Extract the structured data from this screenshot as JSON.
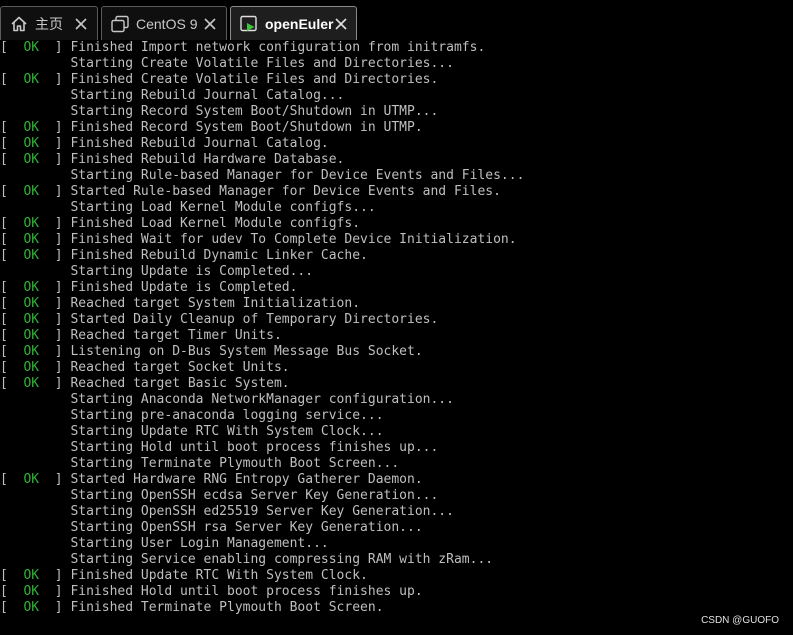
{
  "tabs": [
    {
      "label": "主页",
      "icon": "home-icon",
      "active": false
    },
    {
      "label": "CentOS 9",
      "icon": "terminal-window-icon",
      "active": false
    },
    {
      "label": "openEuler",
      "icon": "terminal-play-icon",
      "active": true
    }
  ],
  "colors": {
    "background": "#000000",
    "text": "#bfbfbf",
    "ok": "#2fb52f",
    "tab_active": "#1e1e1e",
    "tab_inactive": "#0f0f0f"
  },
  "console": {
    "ok_label": "OK",
    "lines": [
      {
        "ok": true,
        "text": "Finished Import network configuration from initramfs."
      },
      {
        "ok": false,
        "text": "Starting Create Volatile Files and Directories..."
      },
      {
        "ok": true,
        "text": "Finished Create Volatile Files and Directories."
      },
      {
        "ok": false,
        "text": "Starting Rebuild Journal Catalog..."
      },
      {
        "ok": false,
        "text": "Starting Record System Boot/Shutdown in UTMP..."
      },
      {
        "ok": true,
        "text": "Finished Record System Boot/Shutdown in UTMP."
      },
      {
        "ok": true,
        "text": "Finished Rebuild Journal Catalog."
      },
      {
        "ok": true,
        "text": "Finished Rebuild Hardware Database."
      },
      {
        "ok": false,
        "text": "Starting Rule-based Manager for Device Events and Files..."
      },
      {
        "ok": true,
        "text": "Started Rule-based Manager for Device Events and Files."
      },
      {
        "ok": false,
        "text": "Starting Load Kernel Module configfs..."
      },
      {
        "ok": true,
        "text": "Finished Load Kernel Module configfs."
      },
      {
        "ok": true,
        "text": "Finished Wait for udev To Complete Device Initialization."
      },
      {
        "ok": true,
        "text": "Finished Rebuild Dynamic Linker Cache."
      },
      {
        "ok": false,
        "text": "Starting Update is Completed..."
      },
      {
        "ok": true,
        "text": "Finished Update is Completed."
      },
      {
        "ok": true,
        "text": "Reached target System Initialization."
      },
      {
        "ok": true,
        "text": "Started Daily Cleanup of Temporary Directories."
      },
      {
        "ok": true,
        "text": "Reached target Timer Units."
      },
      {
        "ok": true,
        "text": "Listening on D-Bus System Message Bus Socket."
      },
      {
        "ok": true,
        "text": "Reached target Socket Units."
      },
      {
        "ok": true,
        "text": "Reached target Basic System."
      },
      {
        "ok": false,
        "text": "Starting Anaconda NetworkManager configuration..."
      },
      {
        "ok": false,
        "text": "Starting pre-anaconda logging service..."
      },
      {
        "ok": false,
        "text": "Starting Update RTC With System Clock..."
      },
      {
        "ok": false,
        "text": "Starting Hold until boot process finishes up..."
      },
      {
        "ok": false,
        "text": "Starting Terminate Plymouth Boot Screen..."
      },
      {
        "ok": true,
        "text": "Started Hardware RNG Entropy Gatherer Daemon."
      },
      {
        "ok": false,
        "text": "Starting OpenSSH ecdsa Server Key Generation..."
      },
      {
        "ok": false,
        "text": "Starting OpenSSH ed25519 Server Key Generation..."
      },
      {
        "ok": false,
        "text": "Starting OpenSSH rsa Server Key Generation..."
      },
      {
        "ok": false,
        "text": "Starting User Login Management..."
      },
      {
        "ok": false,
        "text": "Starting Service enabling compressing RAM with zRam..."
      },
      {
        "ok": true,
        "text": "Finished Update RTC With System Clock."
      },
      {
        "ok": true,
        "text": "Finished Hold until boot process finishes up."
      },
      {
        "ok": true,
        "text": "Finished Terminate Plymouth Boot Screen."
      }
    ]
  },
  "watermark": "CSDN @GUOFO"
}
